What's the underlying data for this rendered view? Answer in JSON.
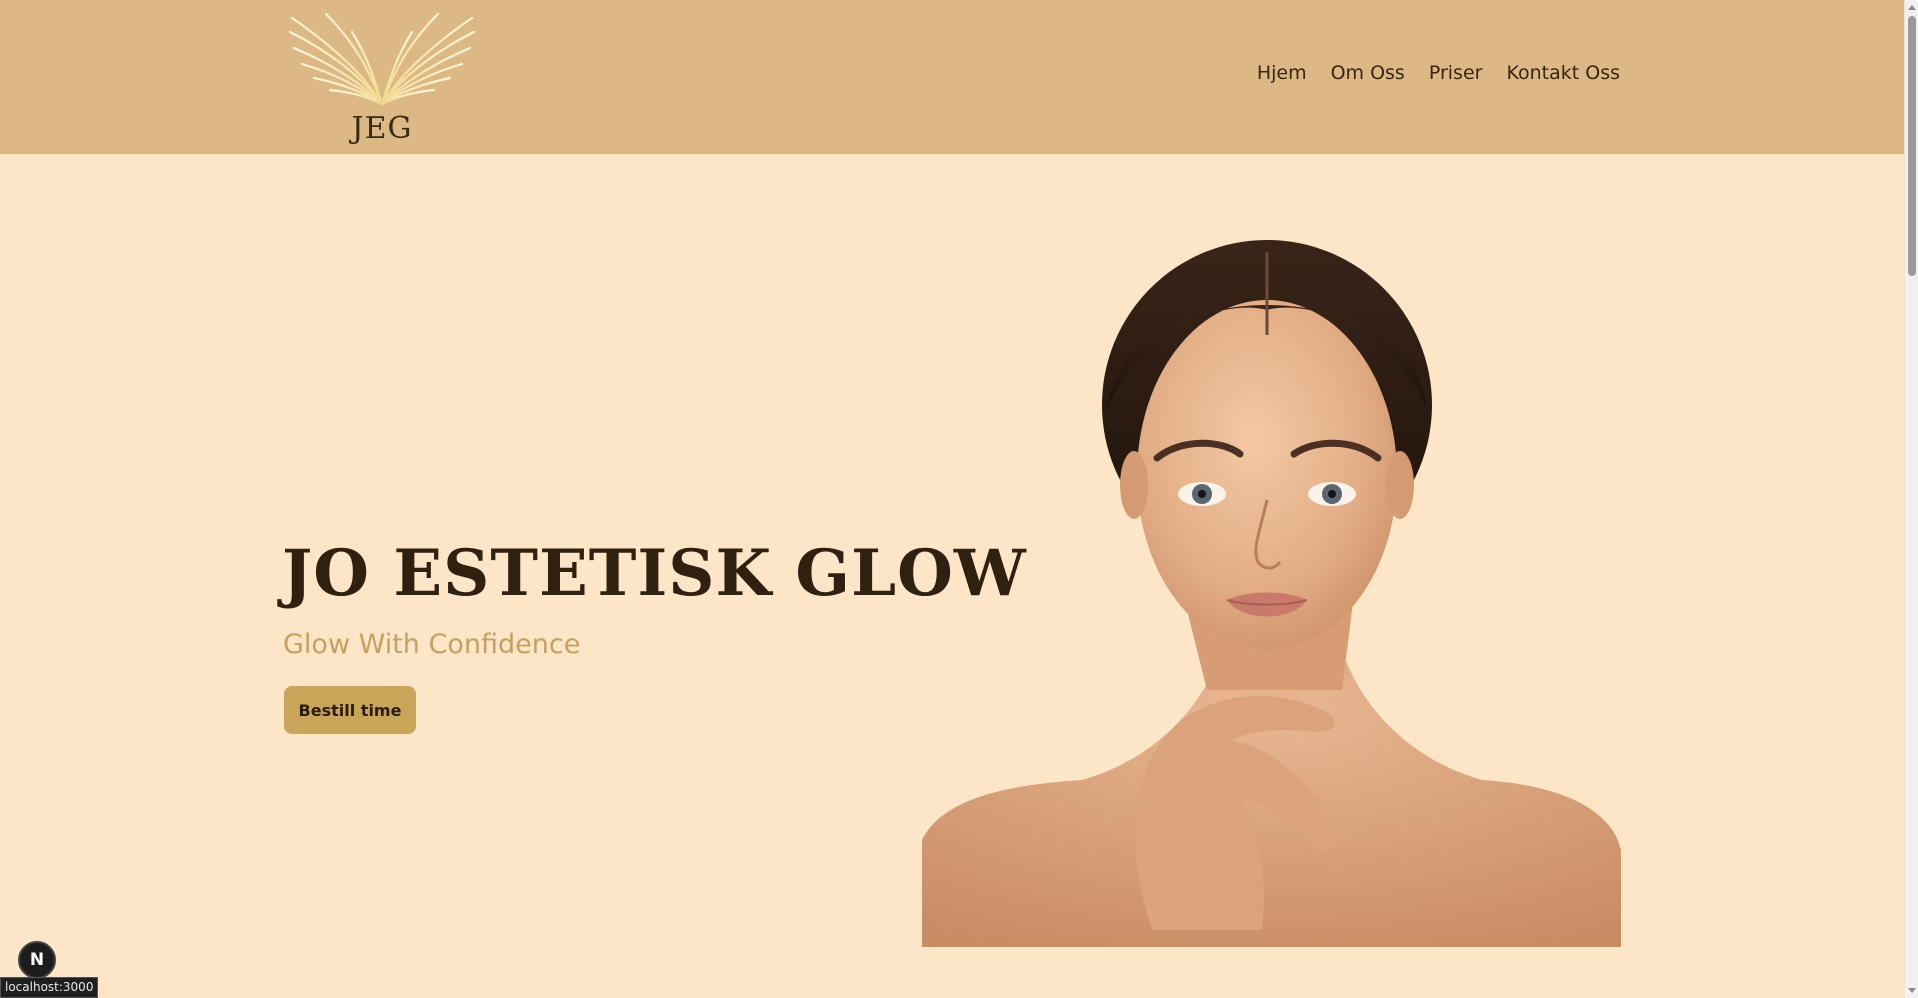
{
  "header": {
    "logo_text": "JEG",
    "nav": [
      {
        "label": "Hjem"
      },
      {
        "label": "Om Oss"
      },
      {
        "label": "Priser"
      },
      {
        "label": "Kontakt Oss"
      }
    ]
  },
  "hero": {
    "title": "JO ESTETISK GLOW",
    "subtitle": "Glow With Confidence",
    "cta_label": "Bestill time"
  },
  "dev_badge": {
    "label": "N"
  },
  "status_bar": {
    "url": "localhost:3000"
  },
  "colors": {
    "header_bg": "#dcb884",
    "page_bg": "#fde6c8",
    "title": "#2f2010",
    "subtitle": "#c6a061",
    "button": "#c9a55a"
  },
  "icons": [
    "wings-logo-icon",
    "scroll-up-arrow-icon",
    "scroll-down-arrow-icon"
  ]
}
